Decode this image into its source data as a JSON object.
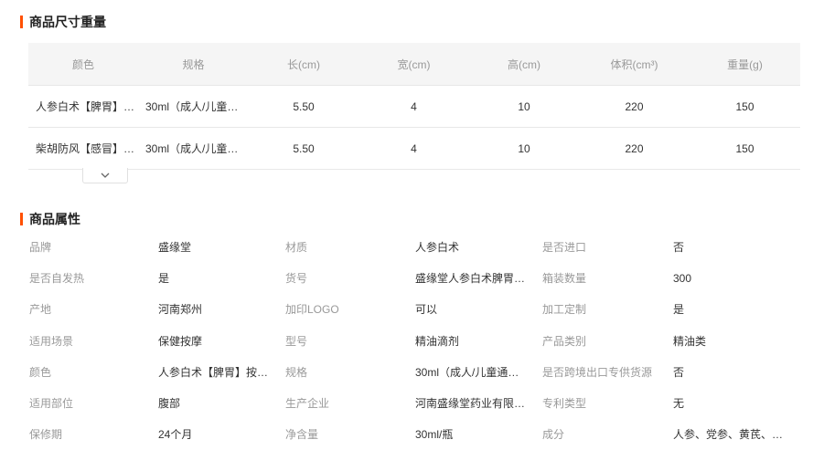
{
  "size_section": {
    "title": "商品尺寸重量",
    "headers": [
      "颜色",
      "规格",
      "长(cm)",
      "宽(cm)",
      "高(cm)",
      "体积(cm³)",
      "重量(g)"
    ],
    "rows": [
      [
        "人参白术【脾胃】…",
        "30ml（成人/儿童…",
        "5.50",
        "4",
        "10",
        "220",
        "150"
      ],
      [
        "柴胡防风【感冒】…",
        "30ml（成人/儿童…",
        "5.50",
        "4",
        "10",
        "220",
        "150"
      ]
    ],
    "expand_icon": "chevron-down-icon"
  },
  "attr_section": {
    "title": "商品属性",
    "rows": [
      [
        [
          "品牌",
          "盛缘堂"
        ],
        [
          "材质",
          "人参白术"
        ],
        [
          "是否进口",
          "否"
        ]
      ],
      [
        [
          "是否自发热",
          "是"
        ],
        [
          "货号",
          "盛缘堂人参白术脾胃…"
        ],
        [
          "箱装数量",
          "300"
        ]
      ],
      [
        [
          "产地",
          "河南郑州"
        ],
        [
          "加印LOGO",
          "可以"
        ],
        [
          "加工定制",
          "是"
        ]
      ],
      [
        [
          "适用场景",
          "保健按摩"
        ],
        [
          "型号",
          "精油滴剂"
        ],
        [
          "产品类别",
          "精油类"
        ]
      ],
      [
        [
          "颜色",
          "人参白术【脾胃】按…"
        ],
        [
          "规格",
          "30ml（成人/儿童通用…"
        ],
        [
          "是否跨境出口专供货源",
          "否"
        ]
      ],
      [
        [
          "适用部位",
          "腹部"
        ],
        [
          "生产企业",
          "河南盛缘堂药业有限…"
        ],
        [
          "专利类型",
          "无"
        ]
      ],
      [
        [
          "保修期",
          "24个月"
        ],
        [
          "净含量",
          "30ml/瓶"
        ],
        [
          "成分",
          "人参、党参、黄芪、…"
        ]
      ]
    ]
  },
  "colors": {
    "accent": "#ff5000",
    "header_bg": "#f5f5f5",
    "label": "#999999",
    "text": "#333333"
  }
}
